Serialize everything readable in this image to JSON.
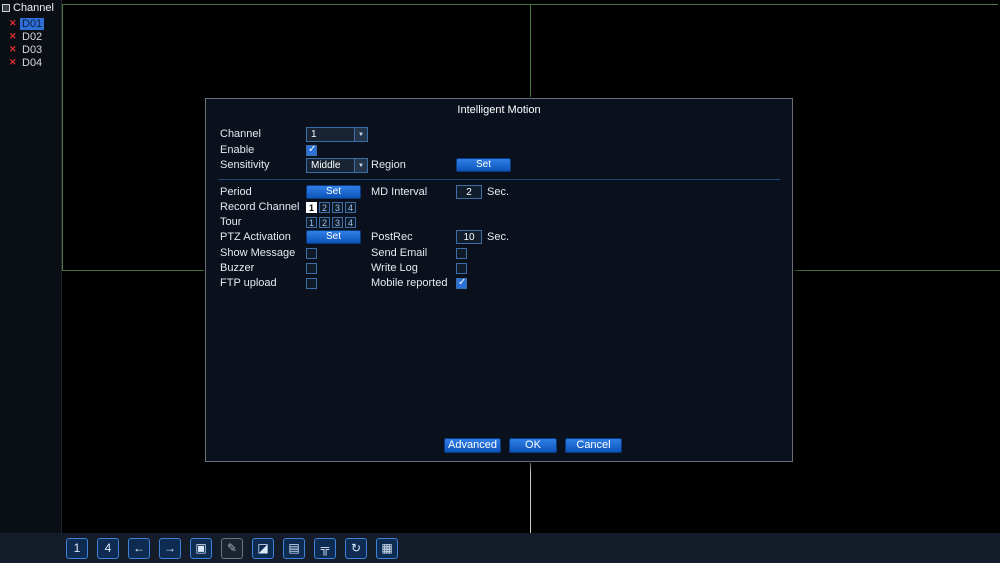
{
  "sidebar": {
    "title": "Channel",
    "channels": [
      {
        "label": "D01",
        "selected": true
      },
      {
        "label": "D02",
        "selected": false
      },
      {
        "label": "D03",
        "selected": false
      },
      {
        "label": "D04",
        "selected": false
      }
    ]
  },
  "dialog": {
    "title": "Intelligent Motion",
    "channel": {
      "label": "Channel",
      "value": "1"
    },
    "enable": {
      "label": "Enable",
      "checked": true
    },
    "sensitivity": {
      "label": "Sensitivity",
      "value": "Middle"
    },
    "region": {
      "label": "Region",
      "button": "Set"
    },
    "period": {
      "label": "Period",
      "button": "Set"
    },
    "md_interval": {
      "label": "MD Interval",
      "value": "2",
      "unit": "Sec."
    },
    "record_channel": {
      "label": "Record Channel",
      "options": [
        {
          "label": "1",
          "selected": true
        },
        {
          "label": "2",
          "selected": false
        },
        {
          "label": "3",
          "selected": false
        },
        {
          "label": "4",
          "selected": false
        }
      ]
    },
    "tour": {
      "label": "Tour",
      "options": [
        {
          "label": "1",
          "selected": false
        },
        {
          "label": "2",
          "selected": false
        },
        {
          "label": "3",
          "selected": false
        },
        {
          "label": "4",
          "selected": false
        }
      ]
    },
    "ptz": {
      "label": "PTZ Activation",
      "button": "Set"
    },
    "postrec": {
      "label": "PostRec",
      "value": "10",
      "unit": "Sec."
    },
    "show_message": {
      "label": "Show Message",
      "checked": false
    },
    "send_email": {
      "label": "Send Email",
      "checked": false
    },
    "buzzer": {
      "label": "Buzzer",
      "checked": false
    },
    "write_log": {
      "label": "Write Log",
      "checked": false
    },
    "ftp_upload": {
      "label": "FTP upload",
      "checked": false
    },
    "mobile_reported": {
      "label": "Mobile reported",
      "checked": true
    },
    "buttons": {
      "advanced": "Advanced",
      "ok": "OK",
      "cancel": "Cancel"
    },
    "dropdown_arrow": "▼"
  },
  "toolbar": {
    "icons": [
      {
        "name": "single-view",
        "glyph": "1"
      },
      {
        "name": "quad-view",
        "glyph": "4"
      },
      {
        "name": "prev-channel",
        "glyph": "←"
      },
      {
        "name": "next-channel",
        "glyph": "→"
      },
      {
        "name": "screen-mode",
        "glyph": "▣"
      },
      {
        "name": "ptz-control",
        "glyph": "✎"
      },
      {
        "name": "color-setting",
        "glyph": "◪"
      },
      {
        "name": "output-adjust",
        "glyph": "▤"
      },
      {
        "name": "network",
        "glyph": "╦"
      },
      {
        "name": "tour-loop",
        "glyph": "↻"
      },
      {
        "name": "channel-grid",
        "glyph": "▦"
      }
    ]
  }
}
